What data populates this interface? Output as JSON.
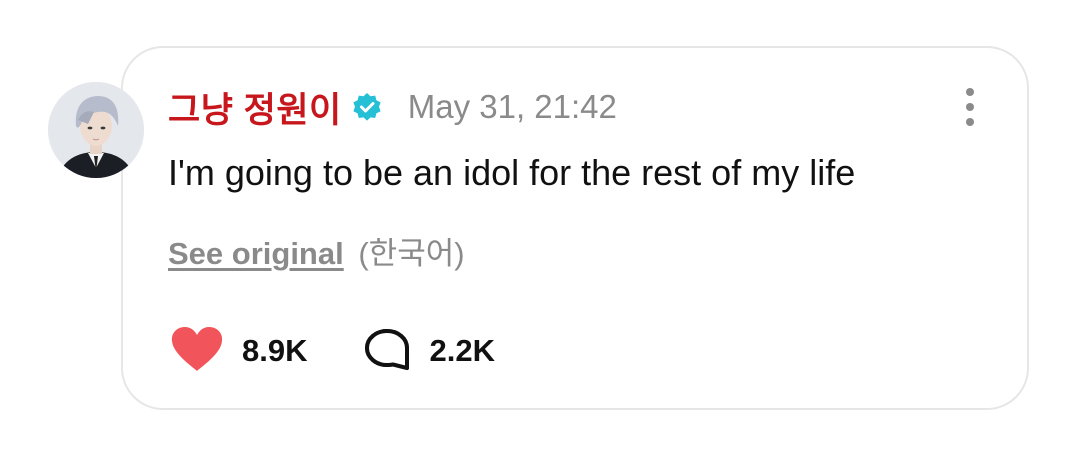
{
  "post": {
    "author": "그냥 정원이",
    "verified_icon": "verified-badge-icon",
    "timestamp": "May 31, 21:42",
    "message": "I'm going to be an idol for the rest of my life",
    "see_original_label": "See original",
    "original_language": "(한국어)",
    "likes": "8.9K",
    "comments": "2.2K",
    "more_icon": "more-vertical-icon",
    "like_icon": "heart-icon",
    "comment_icon": "speech-bubble-icon"
  },
  "colors": {
    "author": "#c7171d",
    "verified": "#25c0d6",
    "heart": "#f2545b",
    "muted": "#8a8a8a",
    "border": "#e6e6e6"
  }
}
